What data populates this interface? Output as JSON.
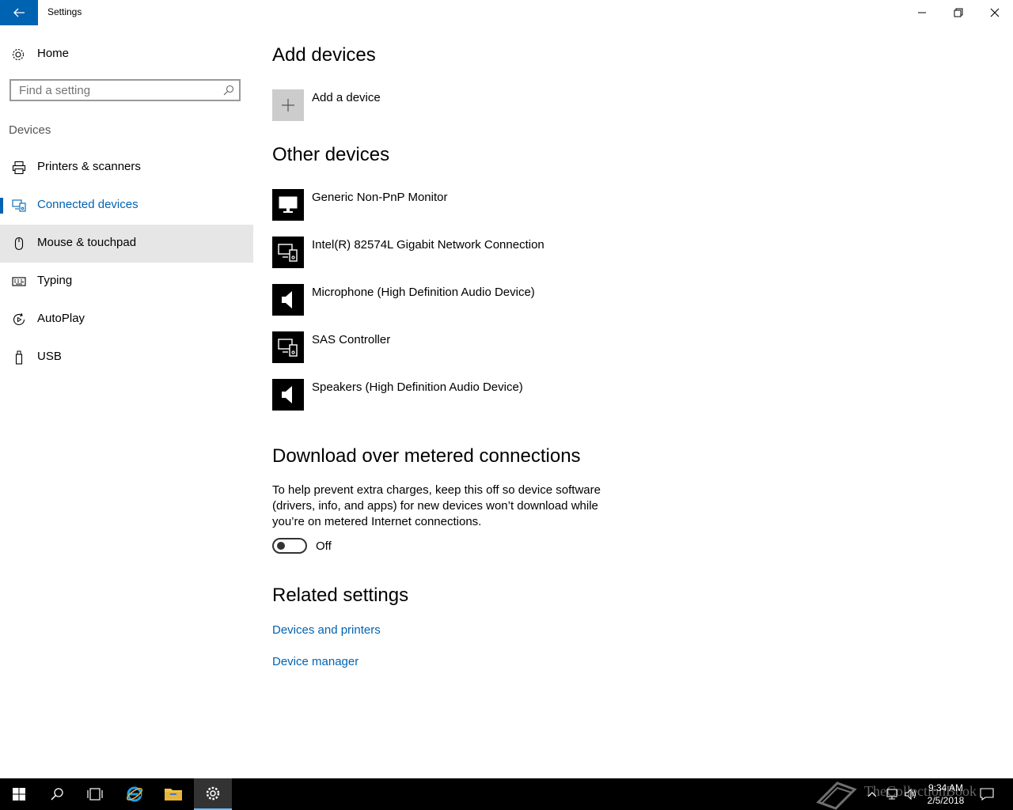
{
  "window": {
    "title": "Settings"
  },
  "sidebar": {
    "home_label": "Home",
    "search_placeholder": "Find a setting",
    "section": "Devices",
    "items": [
      {
        "label": "Printers & scanners",
        "icon": "printer-icon"
      },
      {
        "label": "Connected devices",
        "icon": "connected-devices-icon",
        "selected": true
      },
      {
        "label": "Mouse & touchpad",
        "icon": "mouse-icon",
        "hover": true
      },
      {
        "label": "Typing",
        "icon": "keyboard-icon"
      },
      {
        "label": "AutoPlay",
        "icon": "autoplay-icon"
      },
      {
        "label": "USB",
        "icon": "usb-icon"
      }
    ]
  },
  "main": {
    "add_heading": "Add devices",
    "add_label": "Add a device",
    "other_heading": "Other devices",
    "devices": [
      {
        "name": "Generic Non-PnP Monitor",
        "icon": "monitor-icon"
      },
      {
        "name": "Intel(R) 82574L Gigabit Network Connection",
        "icon": "devices-icon"
      },
      {
        "name": "Microphone (High Definition Audio Device)",
        "icon": "speaker-icon"
      },
      {
        "name": "SAS Controller",
        "icon": "devices-icon"
      },
      {
        "name": "Speakers (High Definition Audio Device)",
        "icon": "speaker-icon"
      }
    ],
    "metered_heading": "Download over metered connections",
    "metered_description": "To help prevent extra charges, keep this off so device software (drivers, info, and apps) for new devices won’t download while you’re on metered Internet connections.",
    "toggle_state": "Off",
    "related_heading": "Related settings",
    "links": [
      "Devices and printers",
      "Device manager"
    ]
  },
  "taskbar": {
    "time": "9:34 AM",
    "date": "2/5/2018",
    "watermark": "TheCollectionBook"
  },
  "colors": {
    "accent": "#0063b1",
    "hover": "#e6e6e6",
    "taskbar": "#000000"
  }
}
